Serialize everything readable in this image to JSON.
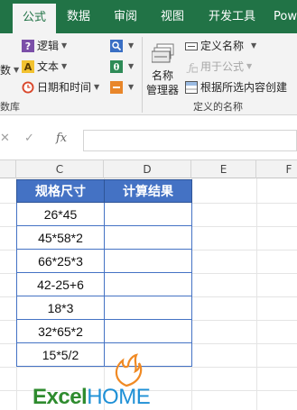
{
  "ribbon_tabs": [
    {
      "label": "公式",
      "active": true
    },
    {
      "label": "数据",
      "active": false
    },
    {
      "label": "审阅",
      "active": false
    },
    {
      "label": "视图",
      "active": false
    },
    {
      "label": "开发工具",
      "active": false
    },
    {
      "label": "Pow",
      "active": false
    }
  ],
  "function_library": {
    "partial_left_1": "数",
    "logical_label": "逻辑",
    "text_label": "文本",
    "datetime_label": "日期和时间",
    "group_label_partial": "数库"
  },
  "defined_names": {
    "name_manager_label_line1": "名称",
    "name_manager_label_line2": "管理器",
    "define_name_label": "定义名称",
    "use_in_formula_label": "用于公式",
    "create_from_selection_label": "根据所选内容创建",
    "group_label": "定义的名称"
  },
  "formula_bar": {
    "fx_label": "fx",
    "value": ""
  },
  "columns": [
    "C",
    "D",
    "E",
    "F"
  ],
  "table": {
    "headers": [
      "规格尺寸",
      "计算结果"
    ],
    "rows": [
      {
        "spec": "26*45",
        "result": ""
      },
      {
        "spec": "45*58*2",
        "result": ""
      },
      {
        "spec": "66*25*3",
        "result": ""
      },
      {
        "spec": "42-25+6",
        "result": ""
      },
      {
        "spec": "18*3",
        "result": ""
      },
      {
        "spec": "32*65*2",
        "result": ""
      },
      {
        "spec": "15*5/2",
        "result": ""
      }
    ]
  },
  "logo": {
    "part1": "Excel",
    "part2": "HOME"
  },
  "colors": {
    "tab_bar": "#217346",
    "header_fill": "#4472c4",
    "logo_green": "#2e8b2e",
    "logo_blue": "#1e90d6",
    "logo_orange": "#f08a24"
  }
}
